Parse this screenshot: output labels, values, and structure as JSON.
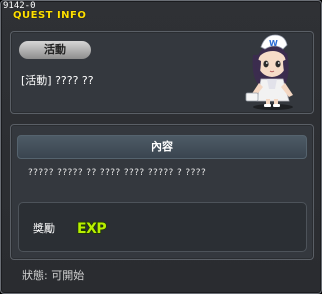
{
  "window": {
    "quest_id": "9142-0",
    "title": "QUEST INFO"
  },
  "quest": {
    "category_badge": "活動",
    "name": "[活動] ???? ??"
  },
  "content": {
    "header": "內容",
    "description": "????? ????? ?? ???? ???? ????? ? ????"
  },
  "reward": {
    "label": "獎勵",
    "icon": "exp-icon",
    "icon_text": "EXP"
  },
  "status": {
    "text": "狀態:  可開始"
  },
  "colors": {
    "title": "#ffe000",
    "exp_fill": "#b8f000"
  }
}
